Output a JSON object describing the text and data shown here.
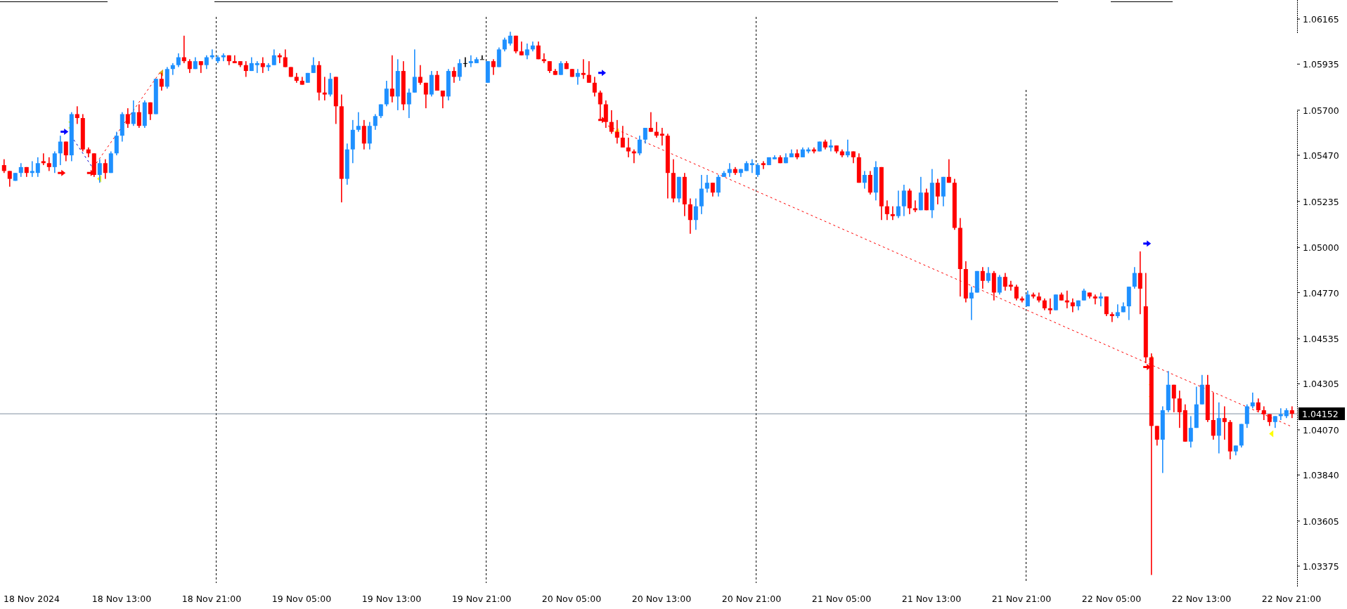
{
  "chart": {
    "chart_data": {
      "type": "candlestick",
      "categories": [
        null,
        null,
        null,
        null,
        null,
        "18 Nov 2024",
        null,
        null,
        null,
        null,
        null,
        null,
        null,
        null,
        null,
        null,
        null,
        null,
        null,
        null,
        null,
        "18 Nov 13:00",
        null,
        null,
        null,
        null,
        null,
        null,
        null,
        null,
        null,
        null,
        null,
        null,
        null,
        null,
        null,
        "18 Nov 21:00",
        null,
        null,
        null,
        null,
        null,
        null,
        null,
        null,
        null,
        null,
        null,
        null,
        null,
        null,
        null,
        "19 Nov 05:00",
        null,
        null,
        null,
        null,
        null,
        null,
        null,
        null,
        null,
        null,
        null,
        null,
        null,
        null,
        null,
        "19 Nov 13:00",
        null,
        null,
        null,
        null,
        null,
        null,
        null,
        null,
        null,
        null,
        null,
        null,
        null,
        null,
        null,
        "19 Nov 21:00",
        null,
        null,
        null,
        null,
        null,
        null,
        null,
        null,
        null,
        null,
        null,
        null,
        null,
        null,
        null,
        "20 Nov 05:00",
        null,
        null,
        null,
        null,
        null,
        null,
        null,
        null,
        null,
        null,
        null,
        null,
        null,
        null,
        null,
        "20 Nov 13:00",
        null,
        null,
        null,
        null,
        null,
        null,
        null,
        null,
        null,
        null,
        null,
        null,
        null,
        null,
        null,
        "20 Nov 21:00",
        null,
        null,
        null,
        null,
        null,
        null,
        null,
        null,
        null,
        null,
        null,
        null,
        null,
        null,
        null,
        "21 Nov 05:00",
        null,
        null,
        null,
        null,
        null,
        null,
        null,
        null,
        null,
        null,
        null,
        null,
        null,
        null,
        null,
        "21 Nov 13:00",
        null,
        null,
        null,
        null,
        null,
        null,
        null,
        null,
        null,
        null,
        null,
        null,
        null,
        null,
        null,
        "21 Nov 21:00",
        null,
        null,
        null,
        null,
        null,
        null,
        null,
        null,
        null,
        null,
        null,
        null,
        null,
        null,
        null,
        "22 Nov 05:00",
        null,
        null,
        null,
        null,
        null,
        null,
        null,
        null,
        null,
        null,
        null,
        null,
        null,
        null,
        null,
        "22 Nov 13:00",
        null,
        null,
        null,
        null,
        null,
        null,
        null,
        null,
        null,
        null,
        null,
        null,
        null,
        null,
        null,
        "22 Nov 21:00"
      ],
      "ylim": [
        1.03289,
        1.06262
      ],
      "yticks": [
        {
          "value": 1.06165,
          "label": "1.06165"
        },
        {
          "value": 1.05935,
          "label": "1.05935"
        },
        {
          "value": 1.057,
          "label": "1.05700"
        },
        {
          "value": 1.0547,
          "label": "1.05470"
        },
        {
          "value": 1.05235,
          "label": "1.05235"
        },
        {
          "value": 1.05,
          "label": "1.05000"
        },
        {
          "value": 1.0477,
          "label": "1.04770"
        },
        {
          "value": 1.04535,
          "label": "1.04535"
        },
        {
          "value": 1.04305,
          "label": "1.04305"
        },
        {
          "value": 1.0407,
          "label": "1.04070"
        },
        {
          "value": 1.0384,
          "label": "1.03840"
        },
        {
          "value": 1.03605,
          "label": "1.03605"
        },
        {
          "value": 1.03375,
          "label": "1.03375"
        }
      ],
      "ohlc": [
        [
          1.0542,
          1.0545,
          1.0538,
          1.0539
        ],
        [
          1.0539,
          1.0539,
          1.0531,
          1.0535
        ],
        [
          1.0534,
          1.0538,
          1.0534,
          1.0538
        ],
        [
          1.0538,
          1.0543,
          1.0536,
          1.0541
        ],
        [
          1.0541,
          1.0541,
          1.0536,
          1.0538
        ],
        [
          1.0538,
          1.0544,
          1.0536,
          1.0539
        ],
        [
          1.0538,
          1.0546,
          1.0536,
          1.0543
        ],
        [
          1.0544,
          1.0548,
          1.0542,
          1.0543
        ],
        [
          1.0543,
          1.0546,
          1.0539,
          1.0541
        ],
        [
          1.0541,
          1.0549,
          1.0538,
          1.0548
        ],
        [
          1.0548,
          1.0557,
          1.0542,
          1.0554
        ],
        [
          1.0554,
          1.0554,
          1.0544,
          1.0547
        ],
        [
          1.0547,
          1.0569,
          1.0544,
          1.0568
        ],
        [
          1.0568,
          1.0572,
          1.0563,
          1.0566
        ],
        [
          1.0566,
          1.0568,
          1.0549,
          1.055
        ],
        [
          1.055,
          1.0551,
          1.0546,
          1.0548
        ],
        [
          1.0548,
          1.0548,
          1.0536,
          1.0537
        ],
        [
          1.0537,
          1.0545,
          1.0533,
          1.0543
        ],
        [
          1.0543,
          1.0545,
          1.0535,
          1.0538
        ],
        [
          1.0538,
          1.0549,
          1.0538,
          1.0548
        ],
        [
          1.0548,
          1.0559,
          1.0547,
          1.0557
        ],
        [
          1.0557,
          1.0569,
          1.0554,
          1.0568
        ],
        [
          1.0568,
          1.0571,
          1.0561,
          1.0563
        ],
        [
          1.0563,
          1.0575,
          1.0562,
          1.0569
        ],
        [
          1.0569,
          1.0573,
          1.0561,
          1.0562
        ],
        [
          1.0562,
          1.0575,
          1.0561,
          1.0574
        ],
        [
          1.0574,
          1.0574,
          1.0565,
          1.0568
        ],
        [
          1.0568,
          1.0586,
          1.0568,
          1.0586
        ],
        [
          1.0586,
          1.0589,
          1.058,
          1.0582
        ],
        [
          1.0582,
          1.0592,
          1.0581,
          1.0591
        ],
        [
          1.0591,
          1.0594,
          1.0588,
          1.0593
        ],
        [
          1.0593,
          1.0599,
          1.0592,
          1.0597
        ],
        [
          1.0597,
          1.0608,
          1.0594,
          1.0595
        ],
        [
          1.0595,
          1.0596,
          1.0589,
          1.0591
        ],
        [
          1.0591,
          1.0597,
          1.0591,
          1.0595
        ],
        [
          1.0595,
          1.0595,
          1.0589,
          1.0593
        ],
        [
          1.0593,
          1.0598,
          1.0591,
          1.0597
        ],
        [
          1.0597,
          1.0601,
          1.0596,
          1.0598
        ],
        [
          1.0595,
          1.0598,
          1.0594,
          1.0597
        ],
        [
          1.0597,
          1.0599,
          1.0595,
          1.0598
        ],
        [
          1.0598,
          1.0598,
          1.0593,
          1.0595
        ],
        [
          1.0595,
          1.0598,
          1.0594,
          1.0594
        ],
        [
          1.0595,
          1.0595,
          1.0592,
          1.0593
        ],
        [
          1.0593,
          1.0595,
          1.0587,
          1.059
        ],
        [
          1.059,
          1.0597,
          1.059,
          1.0594
        ],
        [
          1.0593,
          1.0595,
          1.0589,
          1.0594
        ],
        [
          1.0594,
          1.0597,
          1.0589,
          1.0592
        ],
        [
          1.0592,
          1.0594,
          1.059,
          1.0593
        ],
        [
          1.0593,
          1.0601,
          1.0593,
          1.0598
        ],
        [
          1.0598,
          1.0599,
          1.0594,
          1.0597
        ],
        [
          1.0597,
          1.0601,
          1.0592,
          1.0592
        ],
        [
          1.0592,
          1.0592,
          1.0587,
          1.0587
        ],
        [
          1.0587,
          1.0589,
          1.0584,
          1.0585
        ],
        [
          1.0585,
          1.0587,
          1.0583,
          1.0583
        ],
        [
          1.0584,
          1.0589,
          1.0584,
          1.0589
        ],
        [
          1.0589,
          1.0597,
          1.0589,
          1.0593
        ],
        [
          1.0593,
          1.0595,
          1.0575,
          1.0579
        ],
        [
          1.0579,
          1.0587,
          1.0575,
          1.0578
        ],
        [
          1.0578,
          1.0589,
          1.0577,
          1.0586
        ],
        [
          1.0587,
          1.0587,
          1.0563,
          1.0572
        ],
        [
          1.0572,
          1.0578,
          1.0523,
          1.0535
        ],
        [
          1.0535,
          1.0553,
          1.0532,
          1.055
        ],
        [
          1.055,
          1.0565,
          1.0543,
          1.056
        ],
        [
          1.056,
          1.0569,
          1.0559,
          1.0562
        ],
        [
          1.0562,
          1.0565,
          1.055,
          1.0553
        ],
        [
          1.0553,
          1.0564,
          1.055,
          1.0562
        ],
        [
          1.0562,
          1.0568,
          1.056,
          1.0567
        ],
        [
          1.0567,
          1.0573,
          1.0566,
          1.0573
        ],
        [
          1.0573,
          1.0585,
          1.0572,
          1.0581
        ],
        [
          1.0581,
          1.0598,
          1.0574,
          1.0577
        ],
        [
          1.0577,
          1.0596,
          1.057,
          1.059
        ],
        [
          1.059,
          1.0595,
          1.057,
          1.0573
        ],
        [
          1.0573,
          1.0581,
          1.0566,
          1.0579
        ],
        [
          1.0579,
          1.0601,
          1.0579,
          1.0587
        ],
        [
          1.0587,
          1.0593,
          1.0583,
          1.0584
        ],
        [
          1.0584,
          1.0584,
          1.0571,
          1.0578
        ],
        [
          1.0578,
          1.059,
          1.0577,
          1.0588
        ],
        [
          1.0588,
          1.059,
          1.058,
          1.058
        ],
        [
          1.058,
          1.058,
          1.0571,
          1.0577
        ],
        [
          1.0577,
          1.0591,
          1.0575,
          1.059
        ],
        [
          1.059,
          1.0592,
          1.0584,
          1.0587
        ],
        [
          1.0587,
          1.0596,
          1.0585,
          1.0594
        ],
        [
          1.0594,
          1.0597,
          1.0592,
          1.0594
        ],
        [
          1.0594,
          1.0598,
          1.0592,
          1.0595
        ],
        [
          1.0594,
          1.0597,
          1.0594,
          1.0596
        ],
        [
          1.0596,
          1.0598,
          1.0596,
          1.0596
        ],
        [
          1.0584,
          1.0595,
          1.0584,
          1.0595
        ],
        [
          1.0595,
          1.0596,
          1.0588,
          1.0592
        ],
        [
          1.0592,
          1.0602,
          1.0592,
          1.0601
        ],
        [
          1.0601,
          1.0607,
          1.06,
          1.0606
        ],
        [
          1.0604,
          1.061,
          1.0603,
          1.0608
        ],
        [
          1.0608,
          1.0608,
          1.0599,
          1.06
        ],
        [
          1.06,
          1.0605,
          1.0598,
          1.0598
        ],
        [
          1.0598,
          1.0604,
          1.0596,
          1.0601
        ],
        [
          1.0601,
          1.0605,
          1.06,
          1.0603
        ],
        [
          1.0603,
          1.0605,
          1.0596,
          1.0596
        ],
        [
          1.0596,
          1.0599,
          1.0594,
          1.0595
        ],
        [
          1.0595,
          1.0595,
          1.0589,
          1.059
        ],
        [
          1.059,
          1.0591,
          1.0588,
          1.0588
        ],
        [
          1.0588,
          1.0595,
          1.0588,
          1.0594
        ],
        [
          1.0594,
          1.0595,
          1.0591,
          1.0591
        ],
        [
          1.0591,
          1.0591,
          1.0587,
          1.0587
        ],
        [
          1.0587,
          1.0591,
          1.0583,
          1.0589
        ],
        [
          1.0589,
          1.0596,
          1.0586,
          1.0588
        ],
        [
          1.0588,
          1.0595,
          1.0584,
          1.0584
        ],
        [
          1.0584,
          1.0587,
          1.0577,
          1.0579
        ],
        [
          1.0579,
          1.058,
          1.0565,
          1.0573
        ],
        [
          1.0573,
          1.0575,
          1.0561,
          1.0564
        ],
        [
          1.0564,
          1.057,
          1.0558,
          1.0559
        ],
        [
          1.0559,
          1.0565,
          1.0553,
          1.0556
        ],
        [
          1.0556,
          1.0562,
          1.0551,
          1.0551
        ],
        [
          1.0551,
          1.0556,
          1.0546,
          1.0549
        ],
        [
          1.0549,
          1.055,
          1.0543,
          1.0548
        ],
        [
          1.0548,
          1.0557,
          1.0547,
          1.0555
        ],
        [
          1.0555,
          1.0561,
          1.0553,
          1.0561
        ],
        [
          1.0561,
          1.0569,
          1.0559,
          1.0559
        ],
        [
          1.0559,
          1.0564,
          1.0556,
          1.0557
        ],
        [
          1.0558,
          1.0561,
          1.0552,
          1.0557
        ],
        [
          1.0557,
          1.0558,
          1.0525,
          1.0538
        ],
        [
          1.0538,
          1.0545,
          1.0523,
          1.0525
        ],
        [
          1.0525,
          1.0536,
          1.0523,
          1.0536
        ],
        [
          1.0536,
          1.0538,
          1.0516,
          1.0522
        ],
        [
          1.0522,
          1.0525,
          1.0507,
          1.0514
        ],
        [
          1.0514,
          1.0525,
          1.0509,
          1.0521
        ],
        [
          1.0521,
          1.0537,
          1.0517,
          1.053
        ],
        [
          1.053,
          1.0537,
          1.0528,
          1.0533
        ],
        [
          1.0533,
          1.0533,
          1.0526,
          1.0528
        ],
        [
          1.0528,
          1.0537,
          1.0526,
          1.0536
        ],
        [
          1.0536,
          1.0539,
          1.0536,
          1.0538
        ],
        [
          1.0538,
          1.0543,
          1.0536,
          1.054
        ],
        [
          1.054,
          1.0541,
          1.0537,
          1.0538
        ],
        [
          1.0538,
          1.054,
          1.0536,
          1.054
        ],
        [
          1.0539,
          1.0544,
          1.0539,
          1.0543
        ],
        [
          1.0542,
          1.0545,
          1.0538,
          1.0543
        ],
        [
          1.0537,
          1.0543,
          1.0536,
          1.0542
        ],
        [
          1.0543,
          1.0544,
          1.054,
          1.0542
        ],
        [
          1.0542,
          1.0546,
          1.0542,
          1.0546
        ],
        [
          1.0545,
          1.0547,
          1.0545,
          1.0546
        ],
        [
          1.0546,
          1.0547,
          1.0543,
          1.0543
        ],
        [
          1.0543,
          1.0548,
          1.0543,
          1.0546
        ],
        [
          1.0546,
          1.055,
          1.0546,
          1.0548
        ],
        [
          1.0548,
          1.055,
          1.0545,
          1.0546
        ],
        [
          1.0546,
          1.0551,
          1.0546,
          1.055
        ],
        [
          1.0549,
          1.0551,
          1.0548,
          1.055
        ],
        [
          1.055,
          1.0551,
          1.0548,
          1.0549
        ],
        [
          1.0549,
          1.0554,
          1.0549,
          1.0554
        ],
        [
          1.0554,
          1.0555,
          1.055,
          1.0551
        ],
        [
          1.0551,
          1.0555,
          1.0549,
          1.0552
        ],
        [
          1.0552,
          1.0552,
          1.0548,
          1.0549
        ],
        [
          1.0549,
          1.055,
          1.0546,
          1.0547
        ],
        [
          1.0547,
          1.0555,
          1.0546,
          1.0549
        ],
        [
          1.0549,
          1.0549,
          1.0543,
          1.0546
        ],
        [
          1.0546,
          1.0548,
          1.0533,
          1.0533
        ],
        [
          1.0533,
          1.0539,
          1.053,
          1.0537
        ],
        [
          1.0537,
          1.0539,
          1.0527,
          1.0528
        ],
        [
          1.0528,
          1.0544,
          1.0524,
          1.0541
        ],
        [
          1.0541,
          1.0541,
          1.0514,
          1.0521
        ],
        [
          1.0521,
          1.0524,
          1.0514,
          1.0517
        ],
        [
          1.0517,
          1.0521,
          1.0514,
          1.0516
        ],
        [
          1.0516,
          1.0529,
          1.0515,
          1.0521
        ],
        [
          1.0521,
          1.0532,
          1.0516,
          1.0529
        ],
        [
          1.0529,
          1.053,
          1.0517,
          1.052
        ],
        [
          1.052,
          1.0524,
          1.0518,
          1.0519
        ],
        [
          1.0519,
          1.0536,
          1.0519,
          1.0528
        ],
        [
          1.0528,
          1.053,
          1.0519,
          1.0519
        ],
        [
          1.0519,
          1.054,
          1.0515,
          1.0533
        ],
        [
          1.0533,
          1.0535,
          1.0522,
          1.0526
        ],
        [
          1.0526,
          1.0536,
          1.0521,
          1.0536
        ],
        [
          1.0536,
          1.0545,
          1.0533,
          1.0533
        ],
        [
          1.0533,
          1.0535,
          1.0509,
          1.051
        ],
        [
          1.051,
          1.0515,
          1.0475,
          1.0489
        ],
        [
          1.0489,
          1.0493,
          1.0472,
          1.0474
        ],
        [
          1.0474,
          1.048,
          1.0463,
          1.0477
        ],
        [
          1.0477,
          1.0488,
          1.0477,
          1.0488
        ],
        [
          1.0488,
          1.049,
          1.0479,
          1.0483
        ],
        [
          1.0483,
          1.049,
          1.0482,
          1.0487
        ],
        [
          1.0487,
          1.0488,
          1.0473,
          1.0477
        ],
        [
          1.0477,
          1.0486,
          1.0476,
          1.0485
        ],
        [
          1.0485,
          1.0487,
          1.0478,
          1.048
        ],
        [
          1.0481,
          1.0483,
          1.0478,
          1.048
        ],
        [
          1.048,
          1.0481,
          1.0473,
          1.0474
        ],
        [
          1.0474,
          1.0475,
          1.0472,
          1.0473
        ],
        [
          1.047,
          1.0478,
          1.047,
          1.0476
        ],
        [
          1.0476,
          1.0477,
          1.0474,
          1.0475
        ],
        [
          1.0475,
          1.0477,
          1.0472,
          1.0473
        ],
        [
          1.0473,
          1.0474,
          1.0468,
          1.0469
        ],
        [
          1.0469,
          1.0474,
          1.0466,
          1.0468
        ],
        [
          1.0468,
          1.0476,
          1.0468,
          1.0476
        ],
        [
          1.0476,
          1.0477,
          1.0473,
          1.0473
        ],
        [
          1.0473,
          1.0478,
          1.0469,
          1.0472
        ],
        [
          1.0472,
          1.0474,
          1.0467,
          1.047
        ],
        [
          1.047,
          1.0473,
          1.0468,
          1.0473
        ],
        [
          1.0473,
          1.0479,
          1.0473,
          1.0478
        ],
        [
          1.0477,
          1.0477,
          1.0474,
          1.0475
        ],
        [
          1.0475,
          1.0476,
          1.0471,
          1.0474
        ],
        [
          1.0474,
          1.0477,
          1.047,
          1.0475
        ],
        [
          1.0475,
          1.0475,
          1.0465,
          1.0466
        ],
        [
          1.0466,
          1.0467,
          1.0462,
          1.0465
        ],
        [
          1.0465,
          1.0471,
          1.0464,
          1.0467
        ],
        [
          1.0467,
          1.0472,
          1.0467,
          1.047
        ],
        [
          1.047,
          1.048,
          1.0463,
          1.048
        ],
        [
          1.048,
          1.049,
          1.0479,
          1.0487
        ],
        [
          1.0487,
          1.0498,
          1.0466,
          1.0479
        ],
        [
          1.047,
          1.0487,
          1.0441,
          1.0444
        ],
        [
          1.0444,
          1.0446,
          1.0333,
          1.0409
        ],
        [
          1.0409,
          1.0409,
          1.0399,
          1.0402
        ],
        [
          1.0402,
          1.0419,
          1.0385,
          1.0417
        ],
        [
          1.0417,
          1.0437,
          1.0416,
          1.043
        ],
        [
          1.043,
          1.043,
          1.0416,
          1.0423
        ],
        [
          1.0423,
          1.0427,
          1.0408,
          1.0416
        ],
        [
          1.0417,
          1.042,
          1.0401,
          1.0401
        ],
        [
          1.0401,
          1.0414,
          1.0398,
          1.0408
        ],
        [
          1.0408,
          1.0429,
          1.0408,
          1.042
        ],
        [
          1.042,
          1.0435,
          1.042,
          1.043
        ],
        [
          1.043,
          1.0435,
          1.0411,
          1.0412
        ],
        [
          1.0412,
          1.0426,
          1.0402,
          1.0404
        ],
        [
          1.0404,
          1.0421,
          1.0395,
          1.0413
        ],
        [
          1.0413,
          1.0419,
          1.0402,
          1.0411
        ],
        [
          1.0411,
          1.0412,
          1.0392,
          1.0396
        ],
        [
          1.0396,
          1.0399,
          1.0394,
          1.0399
        ],
        [
          1.0399,
          1.041,
          1.0398,
          1.041
        ],
        [
          1.041,
          1.042,
          1.0408,
          1.0419
        ],
        [
          1.0419,
          1.0426,
          1.0418,
          1.0421
        ],
        [
          1.0421,
          1.0423,
          1.0416,
          1.0417
        ],
        [
          1.0417,
          1.0419,
          1.0412,
          1.0415
        ],
        [
          1.0415,
          1.0415,
          1.0409,
          1.0411
        ],
        [
          1.0411,
          1.0414,
          1.0408,
          1.0414
        ],
        [
          1.0414,
          1.0418,
          1.0412,
          1.0415
        ],
        [
          1.0414,
          1.0418,
          1.0413,
          1.0417
        ],
        [
          1.0417,
          1.0419,
          1.0413,
          1.04152
        ]
      ],
      "ref_lines": [
        {
          "axis": "y",
          "value": 1.04152,
          "label": "1.04152"
        }
      ]
    }
  }
}
